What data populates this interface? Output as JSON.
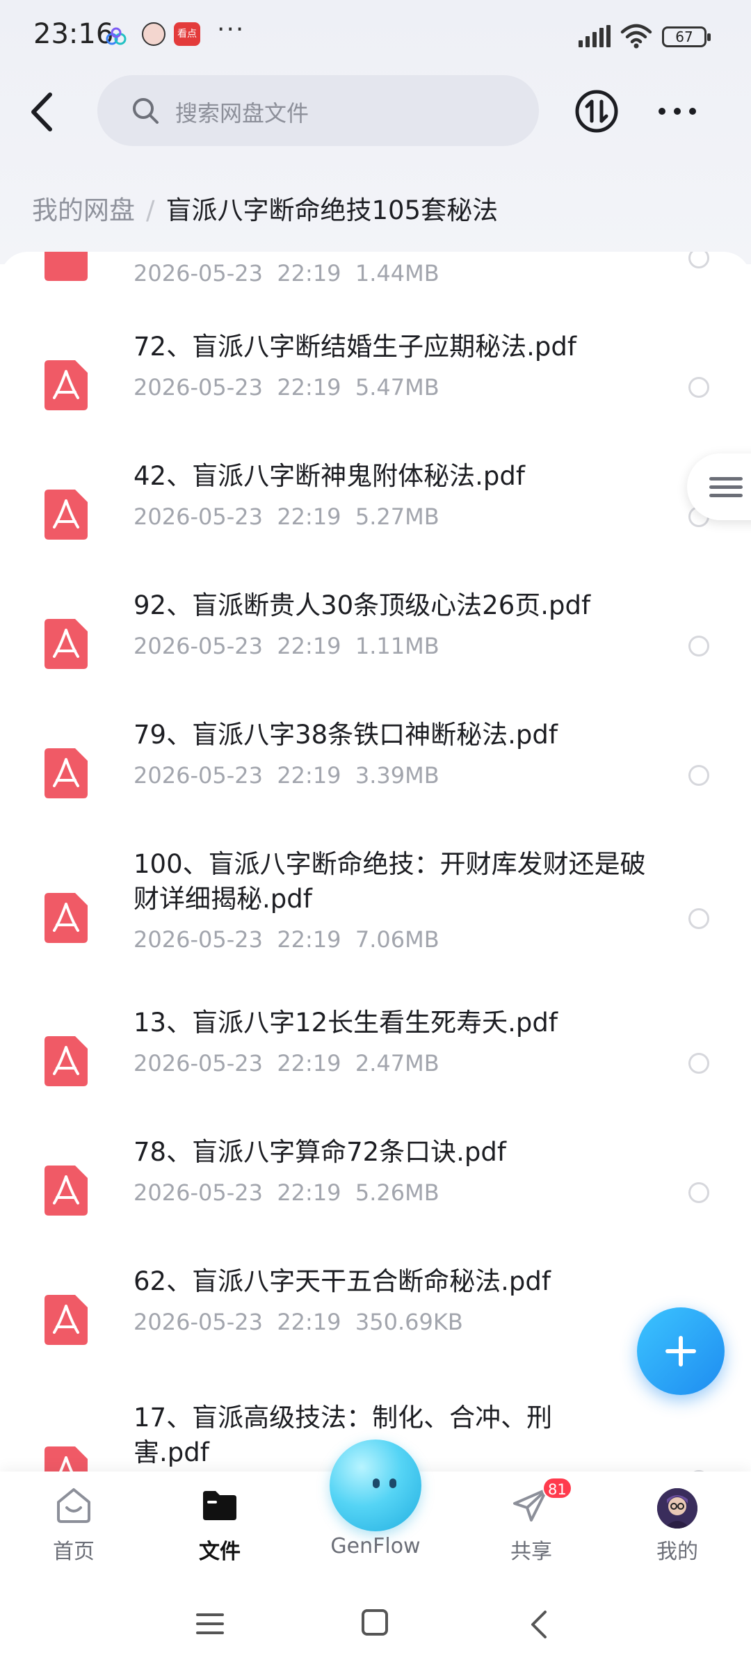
{
  "status_bar": {
    "time": "23:16",
    "more_symbol": "···",
    "battery": "67",
    "app_icon_3_text": "看点"
  },
  "header": {
    "search_placeholder": "搜索网盘文件"
  },
  "breadcrumb": {
    "root": "我的网盘",
    "separator": "/",
    "current": "盲派八字断命绝技105套秘法"
  },
  "files": [
    {
      "name": "",
      "date": "2026-05-23",
      "time": "22:19",
      "size": "1.44MB"
    },
    {
      "name": "72、盲派八字断结婚生子应期秘法.pdf",
      "date": "2026-05-23",
      "time": "22:19",
      "size": "5.47MB"
    },
    {
      "name": "42、盲派八字断神鬼附体秘法.pdf",
      "date": "2026-05-23",
      "time": "22:19",
      "size": "5.27MB"
    },
    {
      "name": "92、盲派断贵人30条顶级心法26页.pdf",
      "date": "2026-05-23",
      "time": "22:19",
      "size": "1.11MB"
    },
    {
      "name": "79、盲派八字38条铁口神断秘法.pdf",
      "date": "2026-05-23",
      "time": "22:19",
      "size": "3.39MB"
    },
    {
      "name": "100、盲派八字断命绝技：开财库发财还是破财详细揭秘.pdf",
      "date": "2026-05-23",
      "time": "22:19",
      "size": "7.06MB"
    },
    {
      "name": "13、盲派八字12长生看生死寿夭.pdf",
      "date": "2026-05-23",
      "time": "22:19",
      "size": "2.47MB"
    },
    {
      "name": "78、盲派八字算命72条口诀.pdf",
      "date": "2026-05-23",
      "time": "22:19",
      "size": "5.26MB"
    },
    {
      "name": "62、盲派八字天干五合断命秘法.pdf",
      "date": "2026-05-23",
      "time": "22:19",
      "size": "350.69KB"
    },
    {
      "name": "17、盲派高级技法：制化、合冲、刑害.pdf",
      "date": "",
      "time": "",
      "size": ""
    }
  ],
  "bottom_nav": {
    "home": "首页",
    "files": "文件",
    "genflow": "GenFlow",
    "share": "共享",
    "share_badge": "81",
    "mine": "我的"
  },
  "colors": {
    "pdf_icon": "#f05a66",
    "fab": "#1e8cf0",
    "badge": "#ff3b4d"
  }
}
